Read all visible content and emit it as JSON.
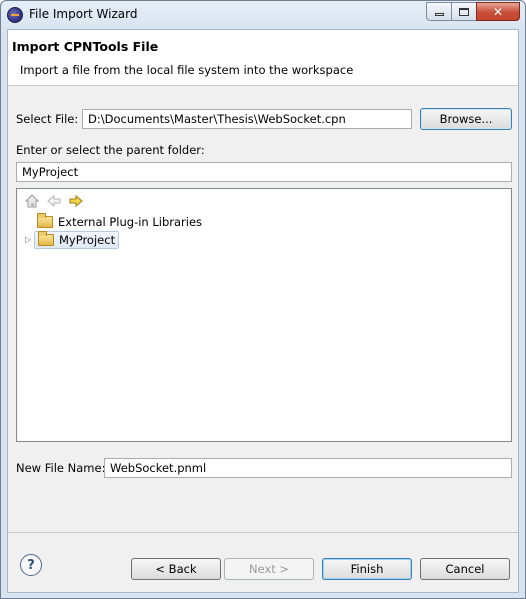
{
  "window": {
    "title": "File Import Wizard",
    "controls": {
      "minimize": "▭",
      "maximize": "□",
      "close": "✕"
    }
  },
  "header": {
    "title": "Import CPNTools File",
    "description": "Import a file from the local file system into the workspace"
  },
  "select_file": {
    "label": "Select File:",
    "value": "D:\\Documents\\Master\\Thesis\\WebSocket.cpn",
    "browse_label": "Browse..."
  },
  "parent_folder": {
    "label": "Enter or select the parent folder:",
    "value": "MyProject"
  },
  "tree": {
    "toolbar": [
      {
        "icon": "home-icon"
      },
      {
        "icon": "back-arrow-icon"
      },
      {
        "icon": "forward-arrow-icon"
      }
    ],
    "items": [
      {
        "label": "External Plug-in Libraries",
        "expandable": false,
        "selected": false
      },
      {
        "label": "MyProject",
        "expandable": true,
        "selected": true
      }
    ]
  },
  "new_file": {
    "label": "New File Name:",
    "value": "WebSocket.pnml"
  },
  "buttons": {
    "help": "?",
    "back": "< Back",
    "next": "Next >",
    "finish": "Finish",
    "cancel": "Cancel"
  }
}
